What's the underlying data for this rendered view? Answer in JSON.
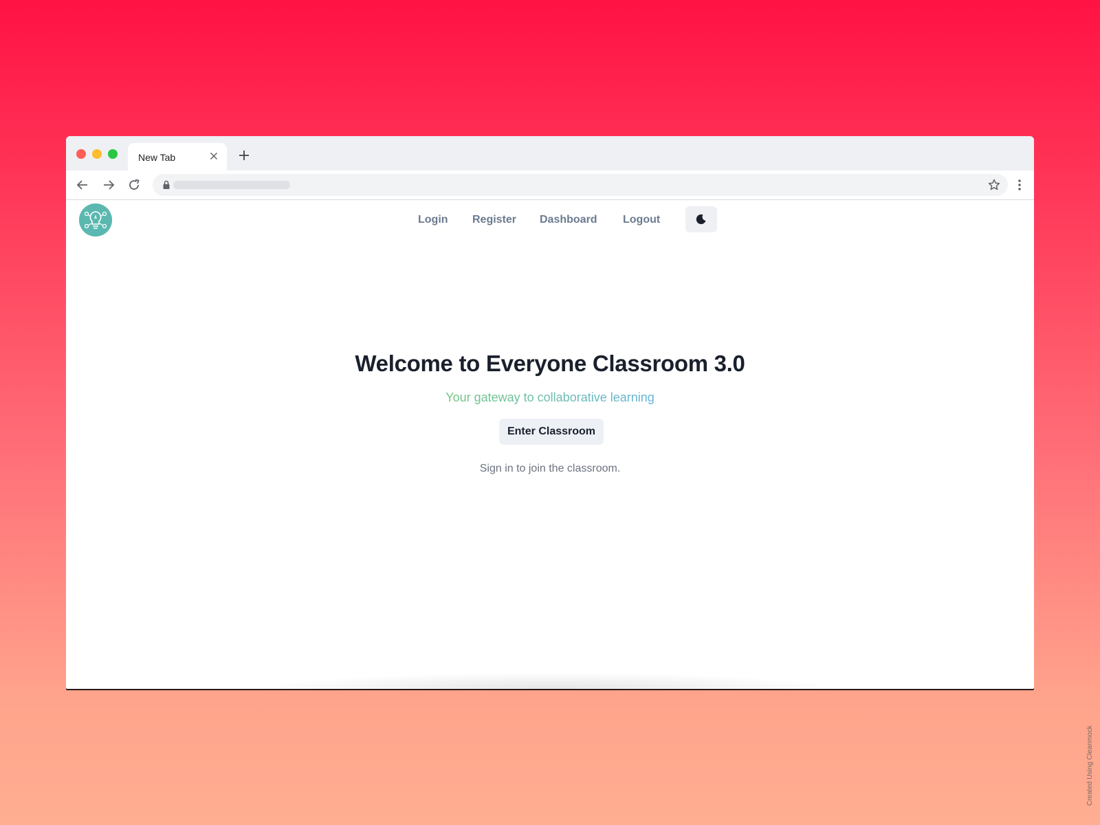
{
  "browser": {
    "tab_title": "New Tab",
    "icons": {
      "close": "close-icon",
      "new_tab": "plus-icon",
      "back": "arrow-left-icon",
      "forward": "arrow-right-icon",
      "reload": "reload-icon",
      "lock": "lock-icon",
      "bookmark": "star-icon",
      "menu": "more-vertical-icon"
    },
    "traffic_light_colors": [
      "#fe5f57",
      "#febc2e",
      "#28c840"
    ]
  },
  "site_nav": {
    "logo_icon": "lightbulb-network-logo",
    "links": [
      "Login",
      "Register",
      "Dashboard",
      "Logout"
    ],
    "theme_toggle_icon": "moon-icon"
  },
  "hero": {
    "title": "Welcome to Everyone Classroom 3.0",
    "subtitle": "Your gateway to collaborative learning",
    "cta_label": "Enter Classroom",
    "note": "Sign in to join the classroom."
  },
  "watermark": "Created Using Cleanmock",
  "colors": {
    "background_top": "#ff1244",
    "background_bottom": "#ffae92",
    "logo": "#5bb8b0",
    "title": "#1a202c",
    "nav_link": "#6b7a90",
    "subtitle_gradient": [
      "#72c57f",
      "#63b4d8"
    ]
  }
}
